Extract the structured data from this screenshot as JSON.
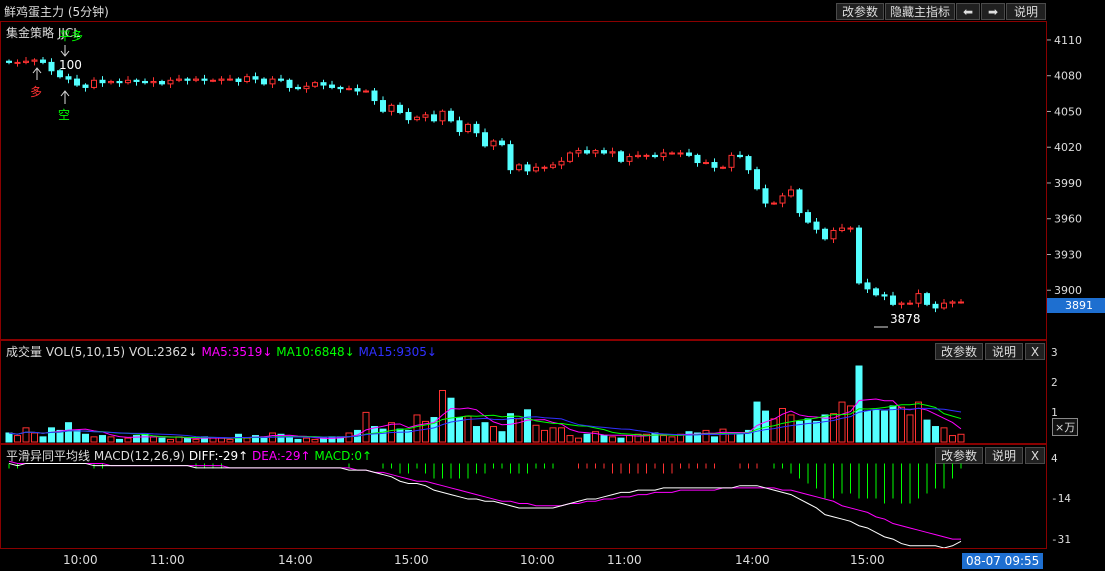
{
  "window": {
    "title": "鲜鸡蛋主力 (5分钟)",
    "buttons": [
      "改参数",
      "隐藏主指标",
      "⬅",
      "➡",
      "说明"
    ]
  },
  "main": {
    "strategy_label": "集金策略 JJCL",
    "signals": {
      "duo1": "多",
      "kong": "空",
      "pingduo": "平多",
      "lot": "100"
    },
    "last_price": "3891",
    "low_label": "3878"
  },
  "volume": {
    "title": "成交量 VOL(5,10,15)",
    "vol": "VOL:2362↓",
    "ma5": "MA5:3519↓",
    "ma10": "MA10:6848↓",
    "ma15": "MA15:9305↓",
    "buttons": [
      "改参数",
      "说明",
      "X"
    ],
    "unit": "×万",
    "ticks": [
      "3",
      "2",
      "1"
    ]
  },
  "macd": {
    "title": "平滑异同平均线",
    "params": "MACD(12,26,9)",
    "diff": "DIFF:-29↑",
    "dea": "DEA:-29↑",
    "macd": "MACD:0↑",
    "buttons": [
      "改参数",
      "说明",
      "X"
    ],
    "ticks": [
      "4",
      "-14",
      "-31"
    ]
  },
  "time_axis": {
    "labels": [
      "10:00",
      "11:00",
      "14:00",
      "15:00",
      "10:00",
      "11:00",
      "14:00",
      "15:00"
    ],
    "cursor_time": "08-07 09:55"
  },
  "colors": {
    "up": "#ff3232",
    "down": "#54ffff",
    "ma5": "#ff00ff",
    "ma10": "#00ff00",
    "ma15": "#3030ff",
    "diff": "#ffffff",
    "dea": "#ff00ff"
  },
  "chart_data": [
    {
      "type": "candlestick",
      "title": "鲜鸡蛋主力 (5分钟)",
      "ylim": [
        3870,
        4115
      ],
      "yticks": [
        4110,
        4080,
        4050,
        4020,
        3990,
        3960,
        3930,
        3900
      ],
      "series": [
        {
          "name": "close",
          "values": [
            4092,
            4092,
            4093,
            4094,
            4092,
            4085,
            4080,
            4078,
            4073,
            4071,
            4077,
            4075,
            4076,
            4075,
            4077,
            4076,
            4075,
            4076,
            4074,
            4077,
            4078,
            4077,
            4078,
            4077,
            4077,
            4078,
            4078,
            4076,
            4080,
            4078,
            4074,
            4078,
            4077,
            4071,
            4070,
            4072,
            4075,
            4073,
            4071,
            4070,
            4070,
            4068,
            4068,
            4060,
            4051,
            4056,
            4050,
            4044,
            4046,
            4048,
            4043,
            4051,
            4043,
            4034,
            4040,
            4033,
            4022,
            4026,
            4023,
            4002,
            4006,
            4001,
            4004,
            4004,
            4006,
            4009,
            4016,
            4018,
            4016,
            4018,
            4016,
            4017,
            4009,
            4013,
            4014,
            4014,
            4013,
            4016,
            4016,
            4016,
            4014,
            4008,
            4008,
            4004,
            4004,
            4014,
            4013,
            4002,
            3986,
            3974,
            3974,
            3980,
            3985,
            3966,
            3958,
            3952,
            3944,
            3951,
            3953,
            3953,
            3907,
            3902,
            3897,
            3896,
            3889,
            3890,
            3890,
            3898,
            3889,
            3886,
            3890,
            3891,
            3891
          ]
        }
      ]
    },
    {
      "type": "bar",
      "title": "成交量 VOL(5,10,15)",
      "ylabel": "×万",
      "ylim": [
        0,
        3.3
      ],
      "values": [
        0.35,
        0.25,
        0.55,
        0.35,
        0.2,
        0.55,
        0.45,
        0.75,
        0.45,
        0.3,
        0.2,
        0.25,
        0.2,
        0.1,
        0.15,
        0.25,
        0.3,
        0.2,
        0.15,
        0.1,
        0.2,
        0.15,
        0.1,
        0.2,
        0.15,
        0.15,
        0.1,
        0.3,
        0.15,
        0.25,
        0.2,
        0.35,
        0.3,
        0.2,
        0.1,
        0.15,
        0.1,
        0.15,
        0.2,
        0.2,
        0.35,
        0.45,
        1.15,
        0.6,
        0.5,
        0.75,
        0.5,
        0.45,
        1.05,
        0.8,
        0.95,
        2.0,
        1.7,
        0.95,
        1.0,
        0.6,
        0.75,
        0.6,
        0.4,
        1.1,
        0.9,
        1.25,
        0.65,
        0.45,
        0.55,
        0.55,
        0.25,
        0.15,
        0.3,
        0.4,
        0.25,
        0.2,
        0.15,
        0.25,
        0.3,
        0.3,
        0.35,
        0.25,
        0.2,
        0.3,
        0.4,
        0.35,
        0.45,
        0.2,
        0.5,
        0.35,
        0.35,
        0.45,
        1.55,
        1.2,
        0.9,
        1.3,
        1.05,
        0.8,
        0.9,
        0.8,
        1.05,
        1.1,
        1.55,
        1.4,
        2.95,
        1.2,
        1.25,
        1.2,
        1.4,
        1.35,
        1.05,
        1.55,
        0.85,
        0.6,
        0.55,
        0.25,
        0.3
      ]
    },
    {
      "type": "line",
      "title": "平滑异同平均线",
      "ylim": [
        -34,
        6
      ],
      "series": [
        {
          "name": "DIFF",
          "values": [
            4,
            3,
            4,
            4,
            4,
            4,
            4,
            4,
            4,
            4,
            3,
            3,
            3,
            3,
            3,
            3,
            3,
            3,
            3,
            3,
            3,
            3,
            2,
            2,
            2,
            2,
            2,
            2,
            2,
            2,
            2,
            2,
            2,
            2,
            2,
            2,
            2,
            2,
            2,
            2,
            1,
            1,
            1,
            0,
            -1,
            -2,
            -4,
            -5,
            -5,
            -6,
            -8,
            -9,
            -10,
            -11,
            -12,
            -12,
            -13,
            -13,
            -14,
            -15,
            -16,
            -16,
            -16,
            -16,
            -16,
            -15,
            -14,
            -13,
            -12,
            -12,
            -11,
            -10,
            -9,
            -9,
            -8,
            -8,
            -8,
            -7,
            -7,
            -7,
            -7,
            -7,
            -7,
            -7,
            -7,
            -7,
            -6,
            -6,
            -6,
            -7,
            -8,
            -9,
            -10,
            -12,
            -14,
            -16,
            -19,
            -20,
            -21,
            -22,
            -24,
            -25,
            -27,
            -29,
            -30,
            -32,
            -33,
            -33,
            -33,
            -33,
            -34,
            -33,
            -31
          ]
        },
        {
          "name": "DEA",
          "values": [
            5,
            4,
            4,
            4,
            4,
            4,
            4,
            4,
            4,
            4,
            4,
            4,
            3,
            3,
            3,
            3,
            3,
            3,
            3,
            3,
            3,
            3,
            3,
            3,
            3,
            3,
            2,
            2,
            2,
            2,
            2,
            2,
            2,
            2,
            2,
            2,
            2,
            2,
            2,
            2,
            2,
            1,
            1,
            0,
            0,
            -1,
            -2,
            -3,
            -4,
            -4,
            -5,
            -6,
            -7,
            -8,
            -9,
            -10,
            -11,
            -12,
            -13,
            -13,
            -14,
            -14,
            -15,
            -15,
            -15,
            -15,
            -14,
            -14,
            -13,
            -13,
            -12,
            -12,
            -11,
            -11,
            -10,
            -10,
            -9,
            -9,
            -9,
            -8,
            -8,
            -8,
            -8,
            -8,
            -7,
            -7,
            -7,
            -7,
            -7,
            -7,
            -7,
            -8,
            -8,
            -9,
            -10,
            -11,
            -12,
            -13,
            -15,
            -16,
            -17,
            -18,
            -20,
            -21,
            -23,
            -24,
            -25,
            -26,
            -27,
            -28,
            -29,
            -30,
            -30
          ]
        }
      ],
      "yticks": [
        4,
        -14,
        -31
      ]
    }
  ]
}
